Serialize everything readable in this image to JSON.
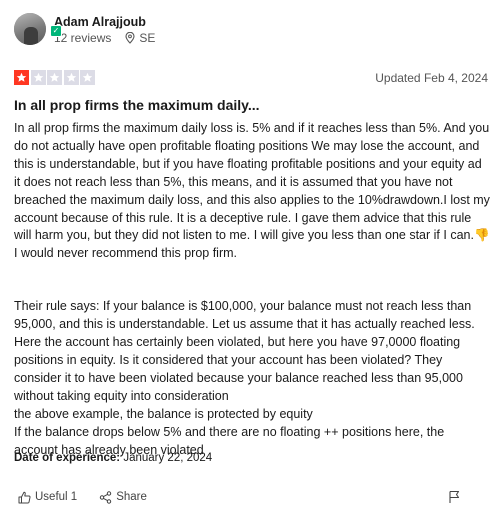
{
  "reviewer": {
    "name": "Adam Alrajjoub",
    "reviews": "12 reviews",
    "location": "SE"
  },
  "rating": {
    "value": 1,
    "max": 5,
    "color_on": "#ff3722",
    "color_off": "#dcdce6"
  },
  "updated": "Updated Feb 4, 2024",
  "review": {
    "title": "In all prop firms the maximum daily...",
    "paragraph1_a": "In all prop firms the maximum daily loss is. 5% and if it reaches less than 5%. And you do not actually have open profitable floating positions We may lose the account, and this is understandable, but if you have floating profitable positions and your equity ad it does not reach less than 5%, this means, and it is assumed that you have not breached the maximum daily loss, and this also applies to the 10%drawdown.I lost my account because of this rule. It is a deceptive rule. I gave them advice that this rule will harm you, but they did not listen to me. I will give you less than one star if I can.",
    "thumbs_down_emoji": "👎",
    "paragraph1_b": " I would never recommend this prop firm.",
    "paragraph2": "Their rule says: If your balance is $100,000, your balance must not reach less than 95,000, and this is understandable. Let us assume that it has actually reached less. Here the account has certainly been violated, but here you have 97,0000 floating positions in equity. Is it considered that your account has been violated? They consider it to have been violated because your balance reached less than 95,000 without taking equity into consideration\nthe above example, the balance is protected by equity\nIf the balance drops below 5% and there are no floating ++ positions here, the account has already been violated"
  },
  "experience": {
    "label": "Date of experience:",
    "date": "January 22, 2024"
  },
  "actions": {
    "useful": "Useful 1",
    "share": "Share"
  },
  "colors": {
    "verified": "#00b67a"
  }
}
